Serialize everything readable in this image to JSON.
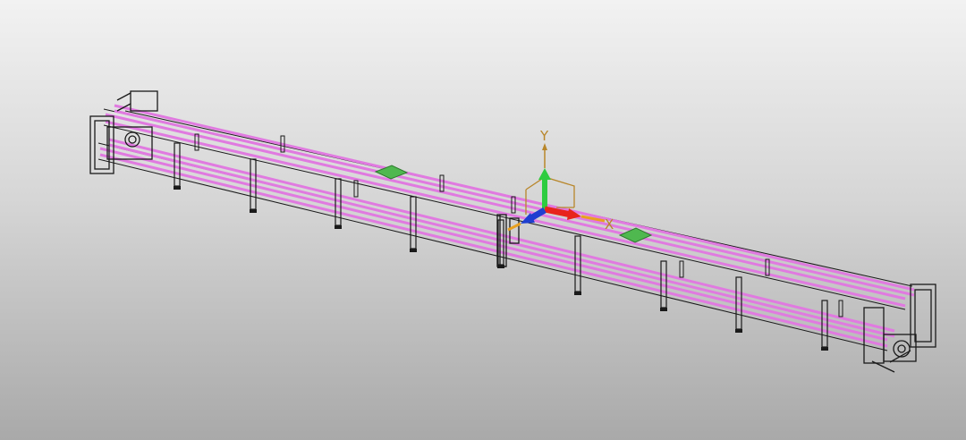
{
  "viewport": {
    "background_top": "#f2f2f2",
    "background_bottom": "#a9a9a9"
  },
  "model": {
    "rail_color": "#e07ae0",
    "frame_color": "#1a1a1a",
    "pallet_color": "#4fb84f"
  },
  "triad": {
    "y_label": "Y",
    "x_label": "X",
    "y_color": "#2ecc40",
    "x_color": "#e8241c",
    "z_color": "#1f3fd0",
    "box_color": "#b8862a",
    "icon": "coordinate-triad-icon"
  }
}
